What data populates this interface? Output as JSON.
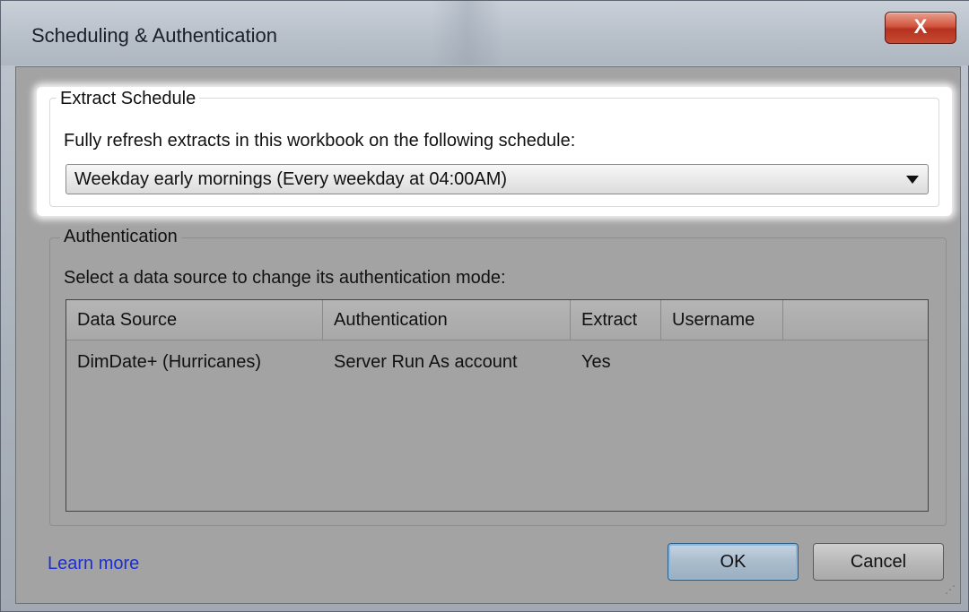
{
  "window": {
    "title": "Scheduling & Authentication",
    "close_label": "X"
  },
  "extract_schedule": {
    "group_title": "Extract Schedule",
    "description": "Fully refresh extracts in this workbook on the following schedule:",
    "selected_schedule": "Weekday early mornings (Every weekday at 04:00AM)"
  },
  "authentication": {
    "group_title": "Authentication",
    "description": "Select a data source to change its authentication mode:",
    "columns": [
      "Data Source",
      "Authentication",
      "Extract",
      "Username",
      ""
    ],
    "rows": [
      {
        "data_source": "DimDate+ (Hurricanes)",
        "authentication": "Server Run As account",
        "extract": "Yes",
        "username": ""
      }
    ]
  },
  "footer": {
    "learn_more": "Learn more",
    "ok_label": "OK",
    "cancel_label": "Cancel"
  },
  "colors": {
    "link": "#1b2fd6",
    "close_button": "#c74a32",
    "dialog_background": "#a3a3a3"
  }
}
